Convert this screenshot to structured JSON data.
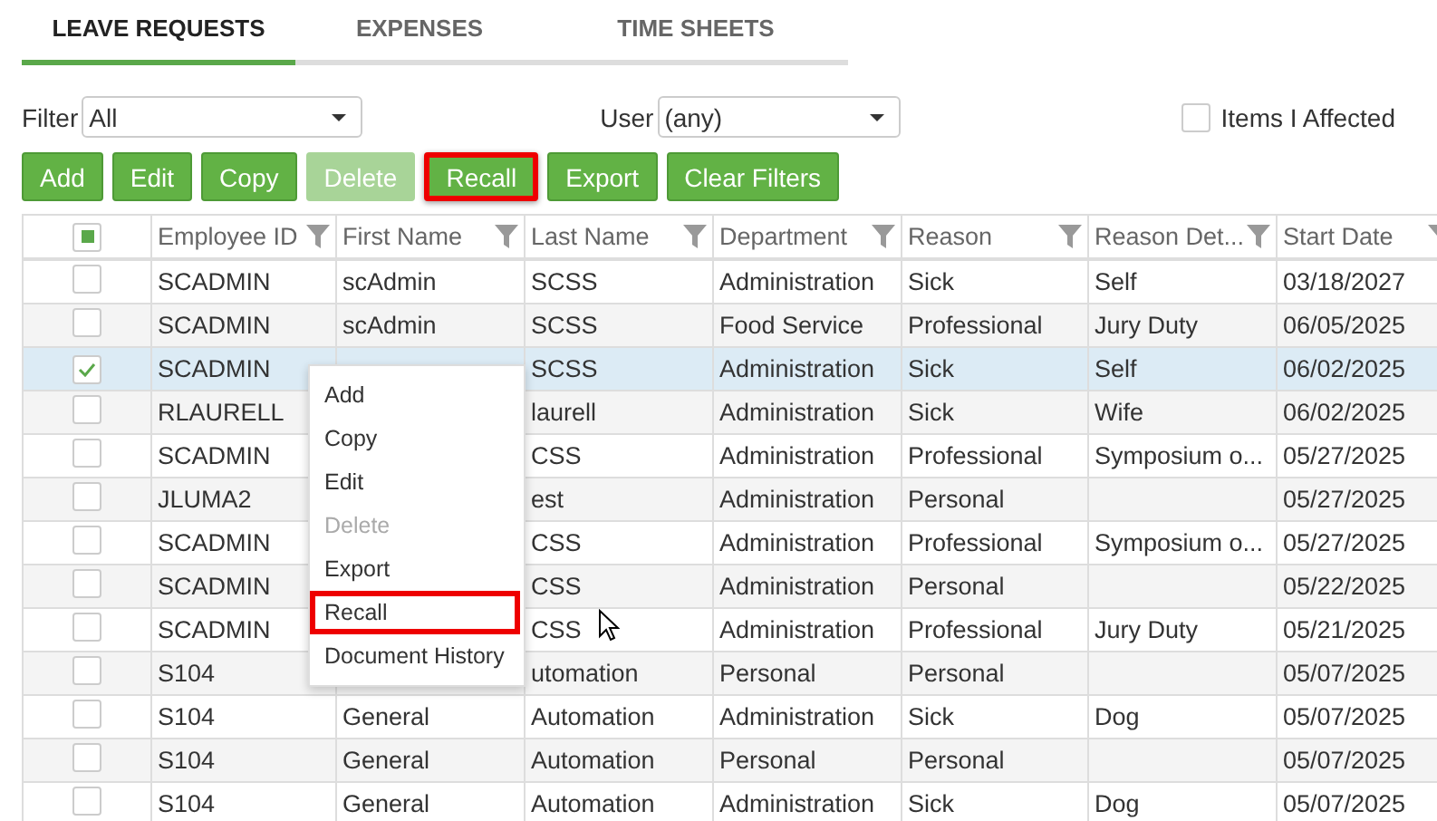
{
  "tabs": [
    {
      "label": "LEAVE REQUESTS",
      "selected": true
    },
    {
      "label": "EXPENSES",
      "selected": false
    },
    {
      "label": "TIME SHEETS",
      "selected": false
    }
  ],
  "filter": {
    "label": "Filter",
    "value": "All"
  },
  "user": {
    "label": "User",
    "value": "(any)"
  },
  "items_affected": {
    "label": "Items I Affected",
    "checked": false
  },
  "buttons": [
    {
      "label": "Add",
      "disabled": false,
      "highlighted": false
    },
    {
      "label": "Edit",
      "disabled": false,
      "highlighted": false
    },
    {
      "label": "Copy",
      "disabled": false,
      "highlighted": false
    },
    {
      "label": "Delete",
      "disabled": true,
      "highlighted": false
    },
    {
      "label": "Recall",
      "disabled": false,
      "highlighted": true
    },
    {
      "label": "Export",
      "disabled": false,
      "highlighted": false
    },
    {
      "label": "Clear Filters",
      "disabled": false,
      "highlighted": false
    }
  ],
  "table": {
    "select_all_partial": true,
    "columns": [
      "Employee ID",
      "First Name",
      "Last Name",
      "Department",
      "Reason",
      "Reason Det...",
      "Start Date"
    ],
    "rows": [
      {
        "selected": false,
        "cells": [
          "SCADMIN",
          "scAdmin",
          "SCSS",
          "Administration",
          "Sick",
          "Self",
          "03/18/2027"
        ]
      },
      {
        "selected": false,
        "cells": [
          "SCADMIN",
          "scAdmin",
          "SCSS",
          "Food Service",
          "Professional",
          "Jury Duty",
          "06/05/2025"
        ]
      },
      {
        "selected": true,
        "cells": [
          "SCADMIN",
          null,
          "SCSS",
          "Administration",
          "Sick",
          "Self",
          "06/02/2025"
        ]
      },
      {
        "selected": false,
        "cells": [
          "RLAURELL",
          null,
          "laurell",
          "Administration",
          "Sick",
          "Wife",
          "06/02/2025"
        ]
      },
      {
        "selected": false,
        "cells": [
          "SCADMIN",
          null,
          "CSS",
          "Administration",
          "Professional",
          "Symposium o...",
          "05/27/2025"
        ]
      },
      {
        "selected": false,
        "cells": [
          "JLUMA2",
          null,
          "est",
          "Administration",
          "Personal",
          null,
          "05/27/2025"
        ]
      },
      {
        "selected": false,
        "cells": [
          "SCADMIN",
          null,
          "CSS",
          "Administration",
          "Professional",
          "Symposium o...",
          "05/27/2025"
        ]
      },
      {
        "selected": false,
        "cells": [
          "SCADMIN",
          null,
          "CSS",
          "Administration",
          "Personal",
          null,
          "05/22/2025"
        ]
      },
      {
        "selected": false,
        "cells": [
          "SCADMIN",
          null,
          "CSS",
          "Administration",
          "Professional",
          "Jury Duty",
          "05/21/2025"
        ]
      },
      {
        "selected": false,
        "cells": [
          "S104",
          null,
          "utomation",
          "Personal",
          "Personal",
          null,
          "05/07/2025"
        ]
      },
      {
        "selected": false,
        "cells": [
          "S104",
          "General",
          "Automation",
          "Administration",
          "Sick",
          "Dog",
          "05/07/2025"
        ]
      },
      {
        "selected": false,
        "cells": [
          "S104",
          "General",
          "Automation",
          "Personal",
          "Personal",
          null,
          "05/07/2025"
        ]
      },
      {
        "selected": false,
        "cells": [
          "S104",
          "General",
          "Automation",
          "Administration",
          "Sick",
          "Dog",
          "05/07/2025"
        ]
      }
    ]
  },
  "context_menu": [
    {
      "label": "Add",
      "disabled": false,
      "highlighted": false
    },
    {
      "label": "Copy",
      "disabled": false,
      "highlighted": false
    },
    {
      "label": "Edit",
      "disabled": false,
      "highlighted": false
    },
    {
      "label": "Delete",
      "disabled": true,
      "highlighted": false
    },
    {
      "label": "Export",
      "disabled": false,
      "highlighted": false
    },
    {
      "label": "Recall",
      "disabled": false,
      "highlighted": true
    },
    {
      "label": "Document History",
      "disabled": false,
      "highlighted": false
    }
  ]
}
